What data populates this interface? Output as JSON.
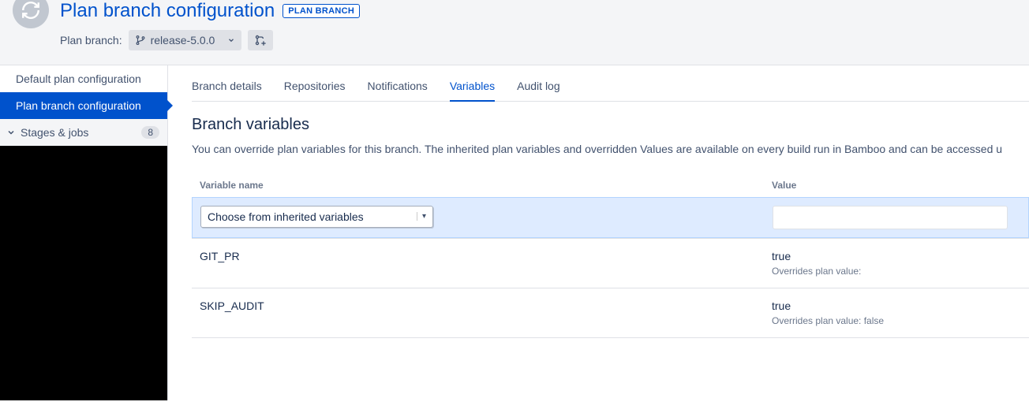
{
  "header": {
    "title": "Plan branch configuration",
    "badge": "PLAN BRANCH",
    "branch_label": "Plan branch:",
    "branch_value": "release-5.0.0"
  },
  "sidebar": {
    "items": [
      {
        "label": "Default plan configuration"
      },
      {
        "label": "Plan branch configuration"
      }
    ],
    "section": {
      "label": "Stages & jobs",
      "count": "8"
    }
  },
  "tabs": [
    {
      "label": "Branch details"
    },
    {
      "label": "Repositories"
    },
    {
      "label": "Notifications"
    },
    {
      "label": "Variables"
    },
    {
      "label": "Audit log"
    }
  ],
  "main": {
    "heading": "Branch variables",
    "description": "You can override plan variables for this branch. The inherited plan variables and overridden Values are available on every build run in Bamboo and can be accessed u",
    "table": {
      "col_name": "Variable name",
      "col_value": "Value",
      "select_placeholder": "Choose from inherited variables",
      "rows": [
        {
          "name": "GIT_PR",
          "value": "true",
          "override": "Overrides plan value:"
        },
        {
          "name": "SKIP_AUDIT",
          "value": "true",
          "override": "Overrides plan value: false"
        }
      ]
    }
  }
}
